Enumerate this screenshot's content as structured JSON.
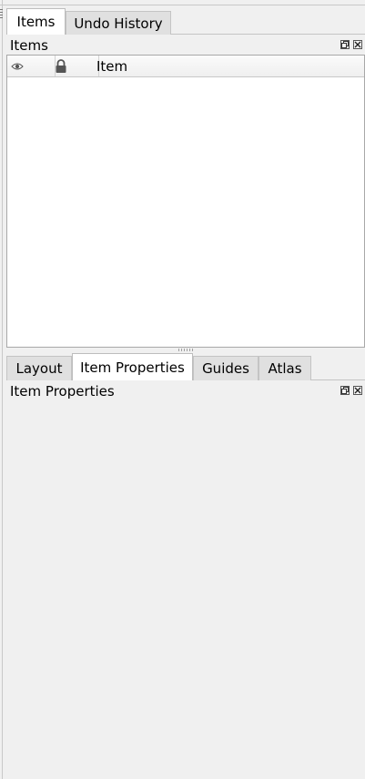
{
  "top_panel": {
    "tabs": [
      {
        "label": "Items",
        "active": true
      },
      {
        "label": "Undo History",
        "active": false
      }
    ],
    "dock_title": "Items",
    "table": {
      "visibility_header_icon": "eye-icon",
      "lock_header_icon": "lock-icon",
      "item_header": "Item"
    }
  },
  "bottom_panel": {
    "tabs": [
      {
        "label": "Layout",
        "active": false
      },
      {
        "label": "Item Properties",
        "active": true
      },
      {
        "label": "Guides",
        "active": false
      },
      {
        "label": "Atlas",
        "active": false
      }
    ],
    "dock_title": "Item Properties"
  },
  "dock_buttons": {
    "float_icon": "float-window-icon",
    "close_icon": "close-icon"
  }
}
